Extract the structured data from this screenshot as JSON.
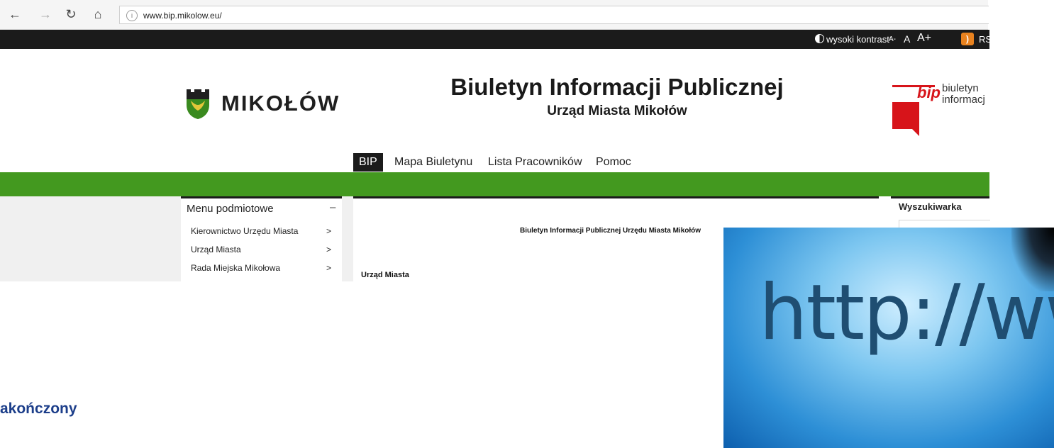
{
  "browser": {
    "url": "www.bip.mikolow.eu/",
    "icons": [
      "back-icon",
      "forward-icon",
      "refresh-icon",
      "home-icon",
      "info-icon"
    ]
  },
  "topbar": {
    "contrast_label": "wysoki kontrast",
    "font_small": "A-",
    "font_normal": "A",
    "font_large": "A+",
    "rss_label": "RS"
  },
  "header": {
    "logo_text": "MIKOŁÓW",
    "title": "Biuletyn Informacji Publicznej",
    "subtitle": "Urząd Miasta Mikołów",
    "bip_word": "bip",
    "bip_line1": "biuletyn",
    "bip_line2": "informacj"
  },
  "menu": {
    "items": [
      "BIP",
      "Mapa Biuletynu",
      "Lista Pracowników",
      "Pomoc"
    ],
    "active": "BIP"
  },
  "sidebar": {
    "heading": "Menu podmiotowe",
    "collapse_symbol": "–",
    "items": [
      "Kierownictwo Urzędu Miasta",
      "Urząd Miasta",
      "Rada Miejska Mikołowa"
    ]
  },
  "main": {
    "title": "Biuletyn Informacji Publicznej Urzędu Miasta Mikołów",
    "section": "Urząd Miasta"
  },
  "search": {
    "heading": "Wyszukiwarka"
  },
  "caption": "akończony",
  "image_text": "http://ww",
  "colors": {
    "green": "#43991f",
    "dark": "#1b1b1b",
    "caption": "#1c3e8a",
    "bip_red": "#d7141a"
  }
}
